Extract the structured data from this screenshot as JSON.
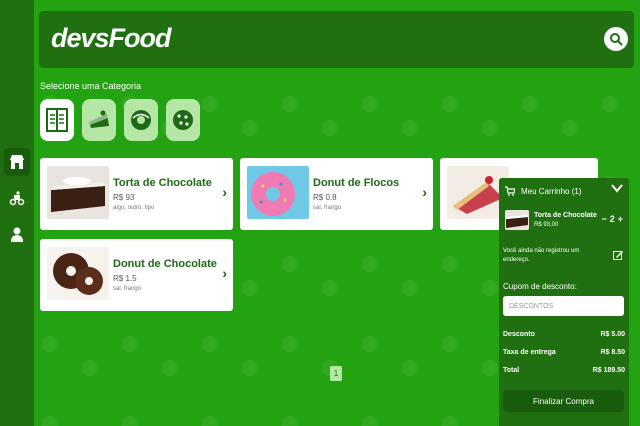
{
  "brand": {
    "logo_text": "devsFood"
  },
  "colors": {
    "sidebar": "#207012",
    "background": "#23a311",
    "accent": "#1d6a14",
    "light": "#b6e6a6"
  },
  "sidebar": {
    "items": [
      {
        "icon": "store-icon",
        "active": true
      },
      {
        "icon": "delivery-bike-icon",
        "active": false
      },
      {
        "icon": "user-icon",
        "active": false
      }
    ]
  },
  "header": {
    "search_icon": "search-icon"
  },
  "categories": {
    "title": "Selecione uma Categoria",
    "items": [
      {
        "icon": "menu-book-icon",
        "active": true
      },
      {
        "icon": "cake-slice-icon",
        "active": false
      },
      {
        "icon": "donut-icon",
        "active": false
      },
      {
        "icon": "cookie-icon",
        "active": false
      }
    ]
  },
  "products": [
    {
      "name": "Torta de Chocolate",
      "price": "R$ 93",
      "ingredients": "algo, outro, tipo"
    },
    {
      "name": "Donut de Flocos",
      "price": "R$ 0.8",
      "ingredients": "sal, frango"
    },
    {
      "name": "Donut de Chocolate",
      "price": "R$ 1.5",
      "ingredients": "sal, frango"
    }
  ],
  "pagination": {
    "current_page": "1"
  },
  "cart": {
    "title": "Meu Carrinho (1)",
    "item": {
      "name": "Torta de Chocolate",
      "price": "R$ 93,00",
      "quantity": "2",
      "minus": "−",
      "plus": "+"
    },
    "address_notice": "Você ainda não registrou um endereço.",
    "coupon_label": "Cupom de desconto:",
    "coupon_placeholder": "DESCONTOS",
    "discount_label": "Desconto",
    "discount_value": "R$ 5.00",
    "delivery_label": "Taxa de entrega",
    "delivery_value": "R$ 8.50",
    "total_label": "Total",
    "total_value": "R$ 189.50",
    "checkout_label": "Finalizar Compra"
  }
}
